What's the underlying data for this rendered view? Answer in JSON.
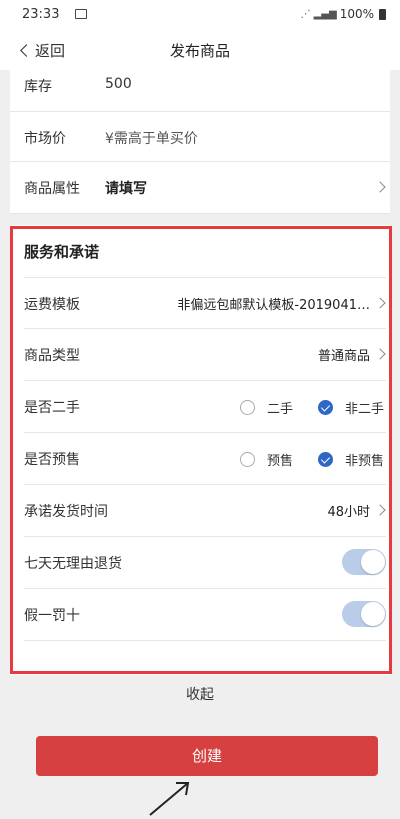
{
  "status": {
    "time": "23:33",
    "right": "100%"
  },
  "nav": {
    "back": "返回",
    "title": "发布商品"
  },
  "top_rows": [
    {
      "label": "库存",
      "value": "500"
    },
    {
      "label": "市场价",
      "value": "¥需高于单买价"
    },
    {
      "label": "商品属性",
      "value": "请填写"
    }
  ],
  "services": {
    "title": "服务和承诺",
    "shipping": {
      "label": "运费模板",
      "value": "非偏远包邮默认模板-2019041…"
    },
    "type": {
      "label": "商品类型",
      "value": "普通商品"
    },
    "secondhand": {
      "label": "是否二手",
      "opt1": "二手",
      "opt2": "非二手",
      "selected": "非二手"
    },
    "presale": {
      "label": "是否预售",
      "opt1": "预售",
      "opt2": "非预售",
      "selected": "非预售"
    },
    "ship_time": {
      "label": "承诺发货时间",
      "value": "48小时"
    },
    "return7": {
      "label": "七天无理由退货",
      "on": true
    },
    "fake": {
      "label": "假一罚十",
      "on": true
    },
    "accent": "#2e67c6",
    "outline_color": "#e53a3f"
  },
  "collapse": "收起",
  "create": "创建",
  "create_color": "#d64040"
}
